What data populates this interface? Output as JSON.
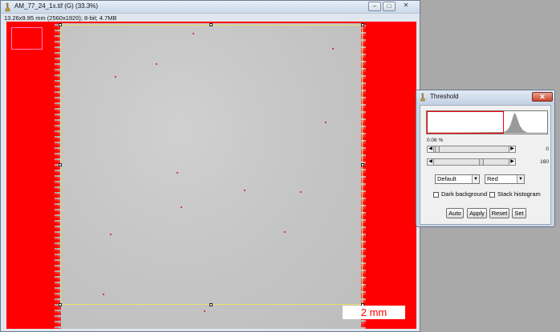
{
  "image_window": {
    "title": "AM_77_24_1x.tif (G) (33.3%)",
    "info": "13.26x9.95 mm (2560x1920); 8-bit; 4.7MB",
    "buttons": {
      "minimize": "–",
      "restore": "□",
      "close": "✕"
    },
    "scale_bar_label": "2 mm"
  },
  "threshold_dialog": {
    "title": "Threshold",
    "close": "✕",
    "percentage": "0.06 %",
    "slider_min_value": "0",
    "slider_max_value": "160",
    "slider_min_fraction": 0.0,
    "slider_max_fraction": 0.63,
    "method_select": "Default",
    "color_select": "Red",
    "dark_background_label": "Dark background",
    "stack_histogram_label": "Stack histogram",
    "dark_background_checked": false,
    "stack_histogram_checked": false,
    "buttons": {
      "auto": "Auto",
      "apply": "Apply",
      "reset": "Reset",
      "set": "Set"
    }
  },
  "colors": {
    "threshold_red": "#ff0000",
    "roi_yellow": "#e8e36a",
    "background_gray": "#a9a9a9"
  }
}
